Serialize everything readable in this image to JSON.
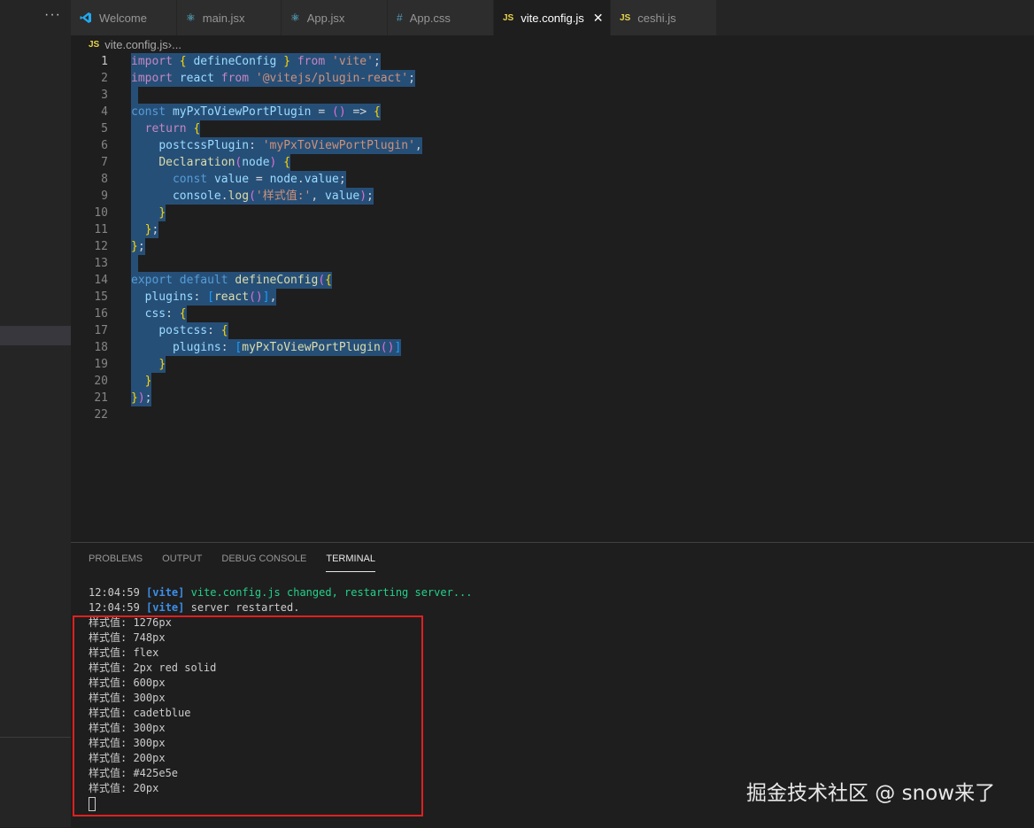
{
  "sidebar": {
    "more_label": "···"
  },
  "tabs": [
    {
      "label": "Welcome",
      "icon": "vscode-icon",
      "active": false
    },
    {
      "label": "main.jsx",
      "icon": "react-icon",
      "active": false
    },
    {
      "label": "App.jsx",
      "icon": "react-icon",
      "active": false
    },
    {
      "label": "App.css",
      "icon": "css-hash-icon",
      "active": false
    },
    {
      "label": "vite.config.js",
      "icon": "js-icon",
      "active": true
    },
    {
      "label": "ceshi.js",
      "icon": "js-icon",
      "active": false
    }
  ],
  "icons": {
    "js": "JS",
    "css": "#",
    "react": "⚛",
    "close": "✕",
    "bulb": "💡"
  },
  "breadcrumb": {
    "file": "vite.config.js",
    "sep": " › ",
    "rest": "..."
  },
  "editor": {
    "line_numbers": [
      "1",
      "2",
      "3",
      "4",
      "5",
      "6",
      "7",
      "8",
      "9",
      "10",
      "11",
      "12",
      "13",
      "14",
      "15",
      "16",
      "17",
      "18",
      "19",
      "20",
      "21",
      "22"
    ],
    "lines": [
      "import { defineConfig } from 'vite';",
      "import react from '@vitejs/plugin-react';",
      "",
      "const myPxToViewPortPlugin = () => {",
      "  return {",
      "    postcssPlugin: 'myPxToViewPortPlugin',",
      "    Declaration(node) {",
      "      const value = node.value;",
      "      console.log('样式值:', value);",
      "    }",
      "  };",
      "};",
      "",
      "export default defineConfig({",
      "  plugins: [react()],",
      "  css: {",
      "    postcss: {",
      "      plugins: [myPxToViewPortPlugin()]",
      "    }",
      "  }",
      "});",
      ""
    ]
  },
  "panel": {
    "tabs": [
      "PROBLEMS",
      "OUTPUT",
      "DEBUG CONSOLE",
      "TERMINAL"
    ],
    "active_tab": "TERMINAL",
    "terminal": {
      "header": [
        {
          "time": "12:04:59",
          "tag": "[vite]",
          "msg": "vite.config.js changed, restarting server..."
        },
        {
          "time": "12:04:59",
          "tag": "[vite]",
          "msg": "server restarted."
        }
      ],
      "output": [
        "样式值: 1276px",
        "样式值: 748px",
        "样式值: flex",
        "样式值: 2px red solid",
        "样式值: 600px",
        "样式值: 300px",
        "样式值: cadetblue",
        "样式值: 300px",
        "样式值: 300px",
        "样式值: 200px",
        "样式值: #425e5e",
        "样式值: 20px"
      ]
    }
  },
  "watermark": "掘金技术社区 @ snow来了"
}
